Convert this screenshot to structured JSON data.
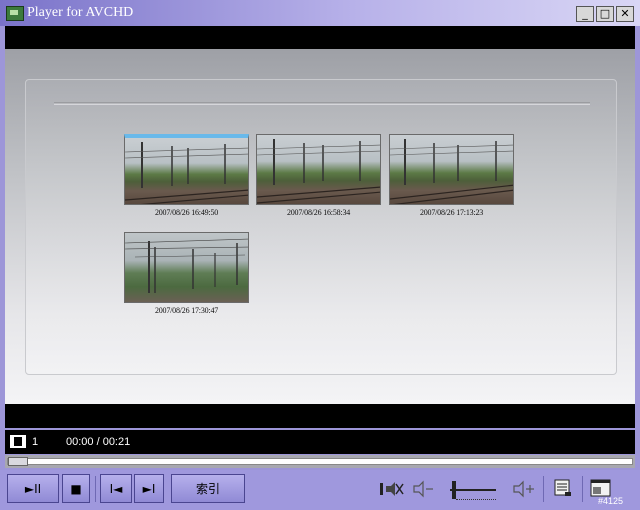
{
  "window": {
    "title": "Player for AVCHD",
    "minimize_glyph": "_",
    "maximize_glyph": "□",
    "close_glyph": "✕"
  },
  "thumbnails": [
    {
      "caption": "2007/08/26 16:49:50",
      "selected": true
    },
    {
      "caption": "2007/08/26 16:58:34",
      "selected": false
    },
    {
      "caption": "2007/08/26 17:13:23",
      "selected": false
    },
    {
      "caption": "2007/08/26 17:30:47",
      "selected": false
    }
  ],
  "info": {
    "clip_number": "1",
    "time": "00:00 / 00:21"
  },
  "progress": {
    "fraction": 0.0
  },
  "controls": {
    "play_pause_glyph": "►II",
    "stop_glyph": "■",
    "prev_glyph": "I◄",
    "next_glyph": "►I",
    "index_label": "索引",
    "mute_icon": "mute-icon",
    "volume_down_icon": "volume-down-icon",
    "volume_up_icon": "volume-up-icon",
    "volume_level": 0.05
  },
  "corner_tag": "#4125"
}
